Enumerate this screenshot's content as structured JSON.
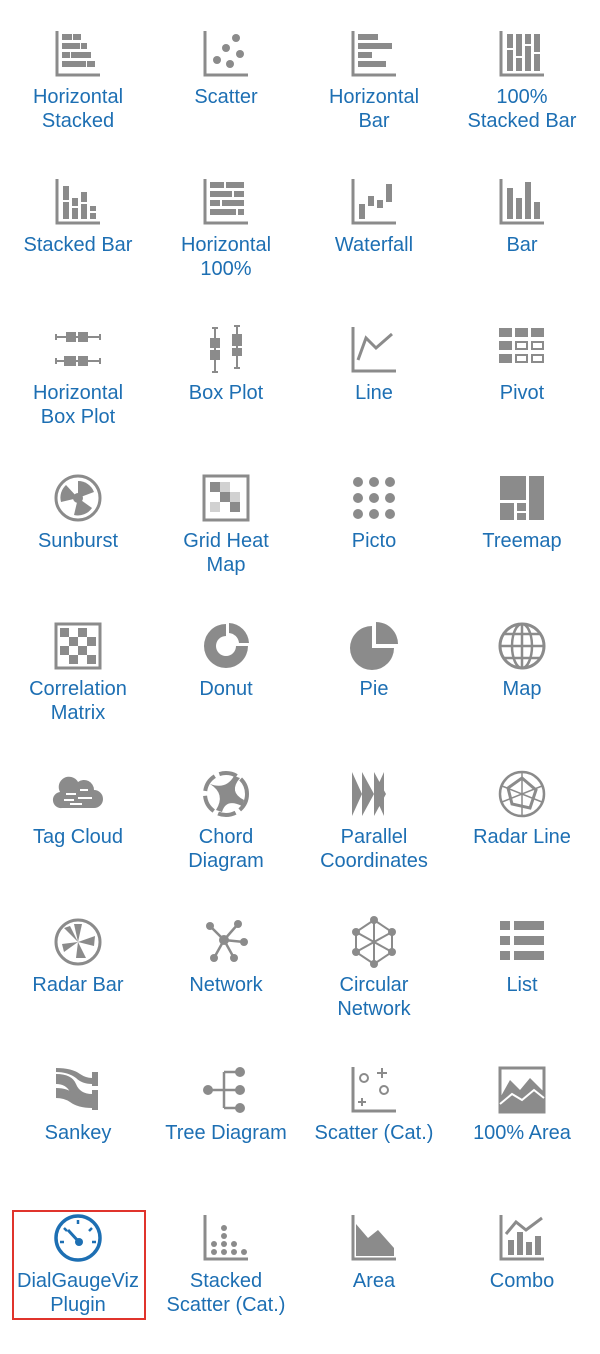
{
  "colors": {
    "icon": "#8b8b8b",
    "label": "#1d6fb3",
    "selected_icon": "#1d6fb3",
    "highlight_border": "#e0342c"
  },
  "viz_types": [
    {
      "id": "horizontal-stacked",
      "label": "Horizontal\nStacked",
      "icon": "horizontal-stacked-icon"
    },
    {
      "id": "scatter",
      "label": "Scatter",
      "icon": "scatter-icon"
    },
    {
      "id": "horizontal-bar",
      "label": "Horizontal\nBar",
      "icon": "horizontal-bar-icon"
    },
    {
      "id": "100-stacked-bar",
      "label": "100%\nStacked Bar",
      "icon": "100-stacked-bar-icon"
    },
    {
      "id": "stacked-bar",
      "label": "Stacked Bar",
      "icon": "stacked-bar-icon"
    },
    {
      "id": "horizontal-100",
      "label": "Horizontal\n100%",
      "icon": "horizontal-100-icon"
    },
    {
      "id": "waterfall",
      "label": "Waterfall",
      "icon": "waterfall-icon"
    },
    {
      "id": "bar",
      "label": "Bar",
      "icon": "bar-icon"
    },
    {
      "id": "horizontal-box-plot",
      "label": "Horizontal\nBox Plot",
      "icon": "horizontal-box-plot-icon"
    },
    {
      "id": "box-plot",
      "label": "Box Plot",
      "icon": "box-plot-icon"
    },
    {
      "id": "line",
      "label": "Line",
      "icon": "line-icon"
    },
    {
      "id": "pivot",
      "label": "Pivot",
      "icon": "pivot-icon"
    },
    {
      "id": "sunburst",
      "label": "Sunburst",
      "icon": "sunburst-icon"
    },
    {
      "id": "grid-heat-map",
      "label": "Grid Heat\nMap",
      "icon": "grid-heat-map-icon"
    },
    {
      "id": "picto",
      "label": "Picto",
      "icon": "picto-icon"
    },
    {
      "id": "treemap",
      "label": "Treemap",
      "icon": "treemap-icon"
    },
    {
      "id": "correlation-matrix",
      "label": "Correlation\nMatrix",
      "icon": "correlation-matrix-icon"
    },
    {
      "id": "donut",
      "label": "Donut",
      "icon": "donut-icon"
    },
    {
      "id": "pie",
      "label": "Pie",
      "icon": "pie-icon"
    },
    {
      "id": "map",
      "label": "Map",
      "icon": "globe-icon"
    },
    {
      "id": "tag-cloud",
      "label": "Tag Cloud",
      "icon": "tag-cloud-icon"
    },
    {
      "id": "chord-diagram",
      "label": "Chord\nDiagram",
      "icon": "chord-diagram-icon"
    },
    {
      "id": "parallel-coordinates",
      "label": "Parallel\nCoordinates",
      "icon": "parallel-coordinates-icon"
    },
    {
      "id": "radar-line",
      "label": "Radar Line",
      "icon": "radar-line-icon"
    },
    {
      "id": "radar-bar",
      "label": "Radar Bar",
      "icon": "radar-bar-icon"
    },
    {
      "id": "network",
      "label": "Network",
      "icon": "network-icon"
    },
    {
      "id": "circular-network",
      "label": "Circular\nNetwork",
      "icon": "circular-network-icon"
    },
    {
      "id": "list",
      "label": "List",
      "icon": "list-icon"
    },
    {
      "id": "sankey",
      "label": "Sankey",
      "icon": "sankey-icon"
    },
    {
      "id": "tree-diagram",
      "label": "Tree Diagram",
      "icon": "tree-diagram-icon"
    },
    {
      "id": "scatter-cat",
      "label": "Scatter (Cat.)",
      "icon": "scatter-cat-icon"
    },
    {
      "id": "100-area",
      "label": "100% Area",
      "icon": "100-area-icon"
    },
    {
      "id": "dialgaugeviz-plugin",
      "label": "DialGaugeViz\nPlugin",
      "icon": "dial-gauge-icon",
      "selected": true
    },
    {
      "id": "stacked-scatter-cat",
      "label": "Stacked\nScatter (Cat.)",
      "icon": "stacked-scatter-cat-icon"
    },
    {
      "id": "area",
      "label": "Area",
      "icon": "area-icon"
    },
    {
      "id": "combo",
      "label": "Combo",
      "icon": "combo-icon"
    }
  ]
}
